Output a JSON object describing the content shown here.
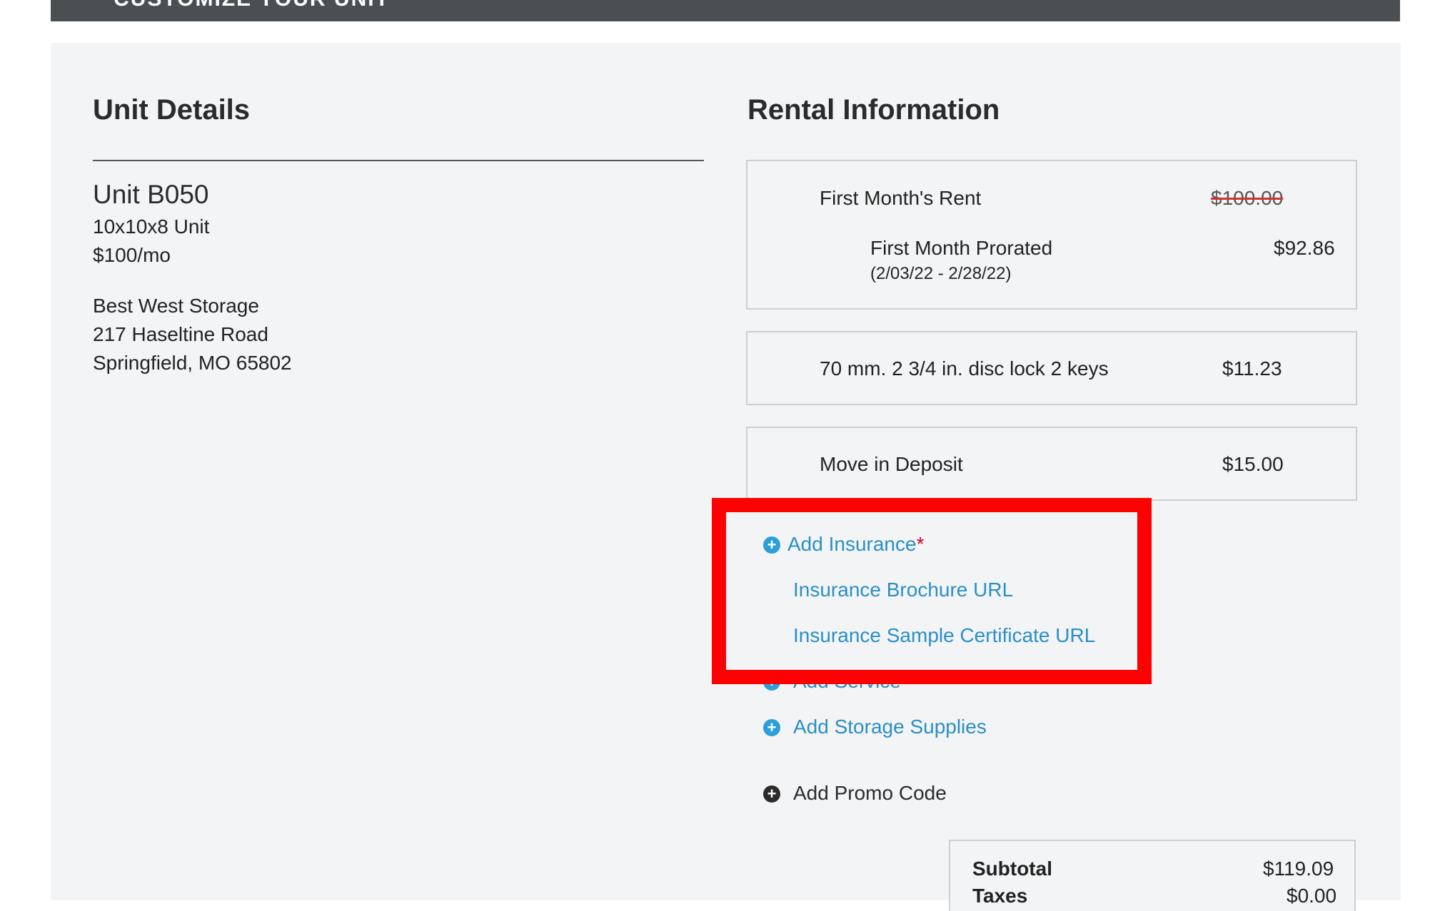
{
  "header": {
    "title": "CUSTOMIZE YOUR UNIT"
  },
  "unit_details": {
    "heading": "Unit Details",
    "unit_name": "Unit B050",
    "size": "10x10x8 Unit",
    "price": "$100/mo",
    "facility_name": "Best West Storage",
    "address_line1": "217 Haseltine Road",
    "address_line2": "Springfield, MO 65802"
  },
  "rental_info": {
    "heading": "Rental Information",
    "first_month": {
      "label": "First Month's Rent",
      "original_price": "$100.00",
      "prorated_label": "First Month Prorated",
      "prorated_dates": "(2/03/22 - 2/28/22)",
      "prorated_price": "$92.86"
    },
    "lock_item": {
      "label": "70 mm. 2 3/4 in. disc lock 2 keys",
      "price": "$11.23"
    },
    "deposit_item": {
      "label": "Move in Deposit",
      "price": "$15.00"
    },
    "add_insurance": {
      "label": "Add Insurance",
      "required_mark": "*"
    },
    "insurance_brochure_link": "Insurance Brochure URL",
    "insurance_certificate_link": "Insurance Sample Certificate URL",
    "add_service": "Add Service",
    "add_storage_supplies": "Add Storage Supplies",
    "add_promo_code": "Add Promo Code"
  },
  "summary": {
    "subtotal_label": "Subtotal",
    "subtotal_value": "$119.09",
    "taxes_label": "Taxes",
    "taxes_value": "$0.00"
  },
  "colors": {
    "link": "#2a8fc6",
    "highlight": "#ff0000",
    "header_bar": "#4b4f51",
    "panel": "#f3f4f5"
  }
}
